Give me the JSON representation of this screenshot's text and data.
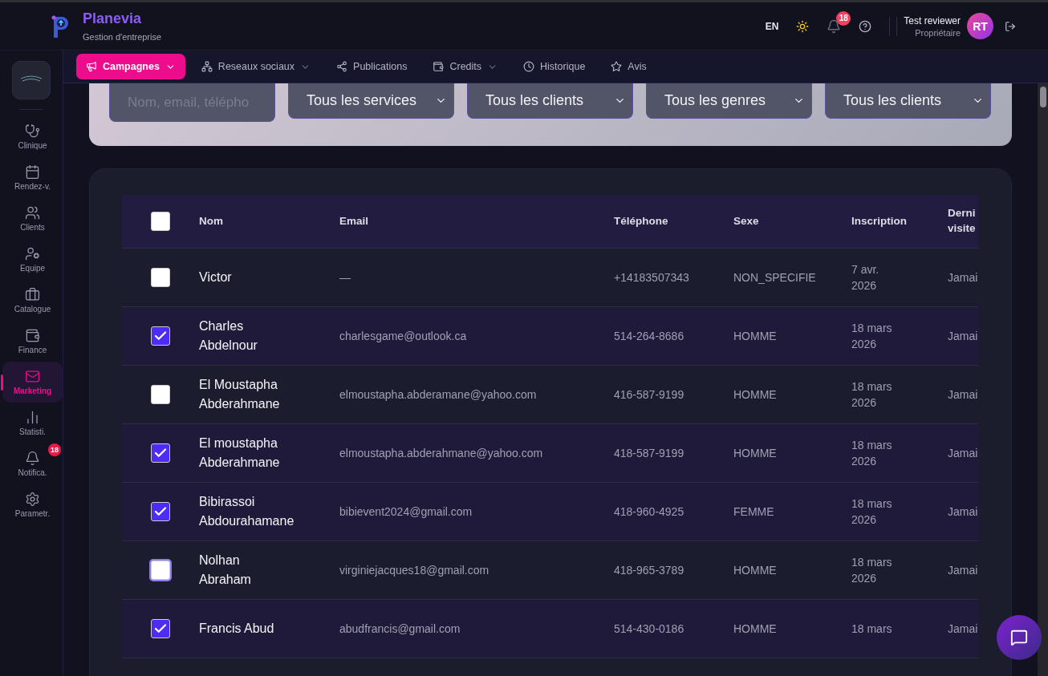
{
  "brand": {
    "name": "Planevia",
    "subtitle": "Gestion d'entreprise"
  },
  "header": {
    "language": "EN",
    "notifications_badge": "18",
    "user_name": "Test reviewer",
    "user_role": "Propriétaire",
    "avatar_initials": "RT"
  },
  "sidebar": {
    "items": [
      {
        "label": "Clinique",
        "selected": false
      },
      {
        "label": "Rendez-v.",
        "selected": false
      },
      {
        "label": "Clients",
        "selected": false
      },
      {
        "label": "Equipe",
        "selected": false
      },
      {
        "label": "Catalogue",
        "selected": false
      },
      {
        "label": "Finance",
        "selected": false
      },
      {
        "label": "Marketing",
        "selected": true
      },
      {
        "label": "Statisti.",
        "selected": false
      },
      {
        "label": "Notifica.",
        "selected": false,
        "badge": "18"
      },
      {
        "label": "Parametr.",
        "selected": false
      }
    ]
  },
  "tabs": [
    {
      "label": "Campagnes",
      "selected": true,
      "dropdown": true
    },
    {
      "label": "Reseaux sociaux",
      "selected": false,
      "dropdown": true
    },
    {
      "label": "Publications",
      "selected": false,
      "dropdown": false
    },
    {
      "label": "Credits",
      "selected": false,
      "dropdown": true
    },
    {
      "label": "Historique",
      "selected": false,
      "dropdown": false
    },
    {
      "label": "Avis",
      "selected": false,
      "dropdown": false
    }
  ],
  "filters": {
    "search": {
      "placeholder": "Nom, email, télépho"
    },
    "selects": [
      "Tous les services",
      "Tous les clients",
      "Tous les genres",
      "Tous les clients"
    ]
  },
  "table": {
    "select_all": {
      "checked": false
    },
    "columns": [
      "Nom",
      "Email",
      "Téléphone",
      "Sexe",
      "Inscription",
      "Derni\nvisite"
    ],
    "rows": [
      {
        "checked": false,
        "focused": false,
        "cells": [
          "Victor",
          "—",
          "+14183507343",
          "NON_SPECIFIE",
          "7 avr.\n2026",
          "Jamai"
        ]
      },
      {
        "checked": true,
        "focused": false,
        "cells": [
          "Charles\nAbdelnour",
          "charlesgame@outlook.ca",
          "514-264-8686",
          "HOMME",
          "18 mars\n2026",
          "Jamai"
        ]
      },
      {
        "checked": false,
        "focused": false,
        "cells": [
          "El Moustapha\nAbderahmane",
          "elmoustapha.abderamane@yahoo.com",
          "416-587-9199",
          "HOMME",
          "18 mars\n2026",
          "Jamai"
        ]
      },
      {
        "checked": true,
        "focused": false,
        "cells": [
          "El moustapha\nAbderahmane",
          "elmoustapha.abderahmane@yahoo.com",
          "418-587-9199",
          "HOMME",
          "18 mars\n2026",
          "Jamai"
        ]
      },
      {
        "checked": true,
        "focused": false,
        "cells": [
          "Bibirassoi\nAbdourahamane",
          "bibievent2024@gmail.com",
          "418-960-4925",
          "FEMME",
          "18 mars\n2026",
          "Jamai"
        ]
      },
      {
        "checked": false,
        "focused": true,
        "cells": [
          "Nolhan\nAbraham",
          "virginiejacques18@gmail.com",
          "418-965-3789",
          "HOMME",
          "18 mars\n2026",
          "Jamai"
        ]
      },
      {
        "checked": true,
        "focused": false,
        "cells": [
          "Francis Abud",
          "abudfrancis@gmail.com",
          "514-430-0186",
          "HOMME",
          "18 mars",
          "Jamai"
        ]
      }
    ]
  }
}
